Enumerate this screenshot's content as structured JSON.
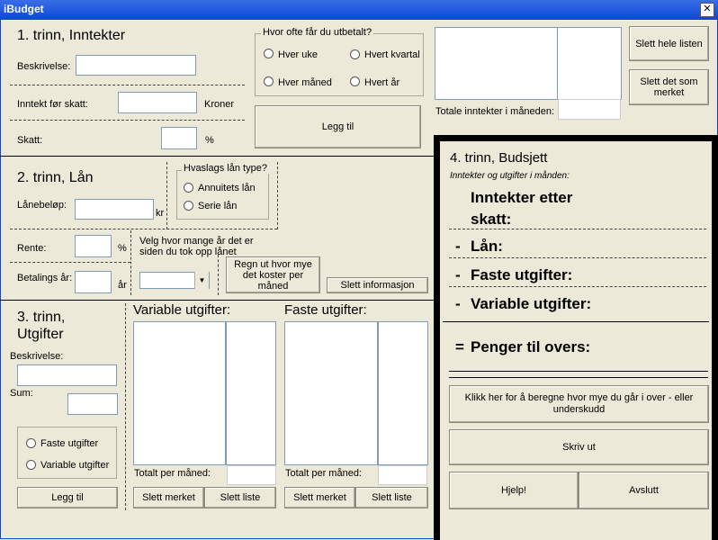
{
  "window": {
    "title": "iBudget",
    "close_glyph": "✕"
  },
  "step1": {
    "title": "1. trinn, Inntekter",
    "desc_label": "Beskrivelse:",
    "income_label": "Inntekt før skatt:",
    "currency": "Kroner",
    "tax_label": "Skatt:",
    "percent": "%",
    "pay_group_title": "Hvor ofte får du utbetalt?",
    "pay_options": [
      "Hver uke",
      "Hvert kvartal",
      "Hver måned",
      "Hvert år"
    ],
    "add_button": "Legg til",
    "total_label": "Totale inntekter i måneden:",
    "clear_all_button": "Slett hele listen",
    "clear_marked_button": "Slett det som merket"
  },
  "step2": {
    "title": "2. trinn, Lån",
    "amount_label": "Lånebeløp:",
    "amount_unit": "kr",
    "type_group_title": "Hvaslags lån type?",
    "type_options": [
      "Annuitets lån",
      "Serie lån"
    ],
    "rate_label": "Rente:",
    "percent": "%",
    "years_label": "Betalings år:",
    "years_unit": "år",
    "since_label": "Velg hvor mange år det er siden du tok opp lånet",
    "calc_button": "Regn ut hvor mye det koster per måned",
    "clear_button": "Slett informasjon"
  },
  "step3": {
    "title": "3. trinn, Utgifter",
    "desc_label": "Beskrivelse:",
    "sum_label": "Sum:",
    "options": [
      "Faste utgifter",
      "Variable utgifter"
    ],
    "add_button": "Legg til",
    "variable_title": "Variable utgifter:",
    "fixed_title": "Faste utgifter:",
    "monthly_total_label": "Totalt per måned:",
    "clear_marked_button": "Slett merket",
    "clear_list_button": "Slett liste"
  },
  "step4": {
    "title": "4. trinn, Budsjett",
    "subtitle": "Inntekter og utgifter i månden:",
    "income_after_tax": "Inntekter etter skatt:",
    "loan_sign": "-",
    "loan": "Lån:",
    "fixed_sign": "-",
    "fixed": "Faste utgifter:",
    "variable_sign": "-",
    "variable": "Variable utgifter:",
    "remaining_sign": "=",
    "remaining": "Penger til overs:",
    "calc_button": "Klikk her for å beregne hvor mye du går i over - eller underskudd",
    "print_button": "Skriv ut",
    "help_button": "Hjelp!",
    "exit_button": "Avslutt"
  }
}
